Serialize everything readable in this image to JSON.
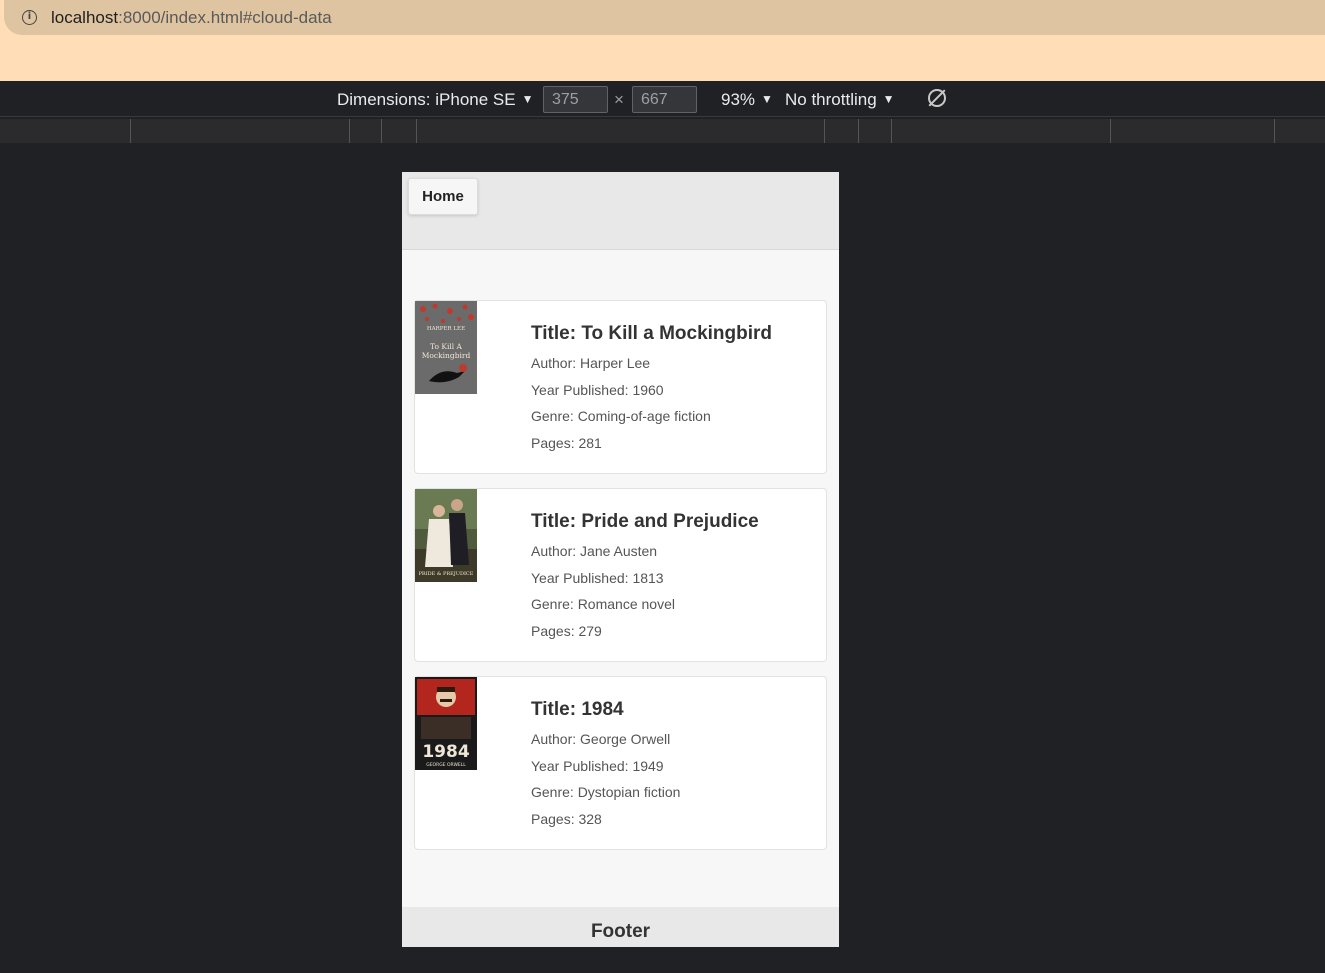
{
  "browser": {
    "url_host": "localhost",
    "url_rest": ":8000/index.html#cloud-data"
  },
  "devtools": {
    "dimensions_label": "Dimensions: iPhone SE",
    "width": "375",
    "times": "×",
    "height": "667",
    "zoom": "93%",
    "throttling": "No throttling",
    "caret": "▼"
  },
  "nav": {
    "home_label": "Home"
  },
  "books": [
    {
      "title": "Title: To Kill a Mockingbird",
      "author": "Author: Harper Lee",
      "year": "Year Published: 1960",
      "genre": "Genre: Coming-of-age fiction",
      "pages": "Pages: 281",
      "cover_text_top": "HARPER LEE",
      "cover_text_main": "To Kill A Mockingbird"
    },
    {
      "title": "Title: Pride and Prejudice",
      "author": "Author: Jane Austen",
      "year": "Year Published: 1813",
      "genre": "Genre: Romance novel",
      "pages": "Pages: 279",
      "cover_text_main": "PRIDE & PREJUDICE"
    },
    {
      "title": "Title: 1984",
      "author": "Author: George Orwell",
      "year": "Year Published: 1949",
      "genre": "Genre: Dystopian fiction",
      "pages": "Pages: 328",
      "cover_text_main": "1984",
      "cover_text_bottom": "GEORGE ORWELL"
    }
  ],
  "footer": {
    "label": "Footer"
  },
  "colors": {
    "page_bg": "#202124",
    "chrome": "#ffdeb7",
    "urlbar": "#dfc4a1"
  }
}
